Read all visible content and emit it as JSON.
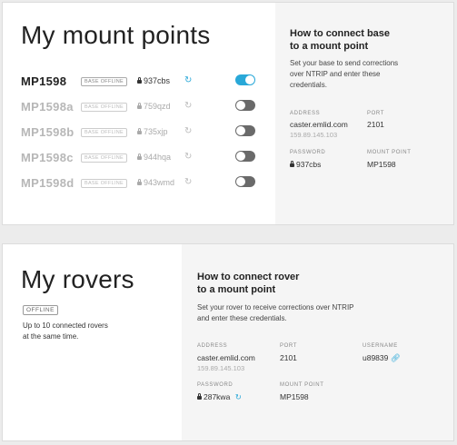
{
  "mount_card": {
    "title": "My mount points",
    "rows": [
      {
        "name": "MP1598",
        "badge": "BASE OFFLINE",
        "password": "937cbs",
        "enabled": true
      },
      {
        "name": "MP1598a",
        "badge": "BASE OFFLINE",
        "password": "759qzd",
        "enabled": false
      },
      {
        "name": "MP1598b",
        "badge": "BASE OFFLINE",
        "password": "735xjp",
        "enabled": false
      },
      {
        "name": "MP1598c",
        "badge": "BASE OFFLINE",
        "password": "944hqa",
        "enabled": false
      },
      {
        "name": "MP1598d",
        "badge": "BASE OFFLINE",
        "password": "943wmd",
        "enabled": false
      }
    ],
    "side": {
      "title_line1": "How to connect base",
      "title_line2": "to a mount point",
      "desc_line1": "Set your base to send corrections",
      "desc_line2": "over NTRIP and enter these",
      "desc_line3": "credentials.",
      "address_label": "ADDRESS",
      "address": "caster.emlid.com",
      "ip": "159.89.145.103",
      "port_label": "PORT",
      "port": "2101",
      "password_label": "PASSWORD",
      "password": "937cbs",
      "mount_label": "MOUNT POINT",
      "mount": "MP1598"
    }
  },
  "rover_card": {
    "title": "My rovers",
    "badge": "OFFLINE",
    "note_line1": "Up to 10 connected rovers",
    "note_line2": "at the same time.",
    "side": {
      "title_line1": "How to connect rover",
      "title_line2": "to a mount point",
      "desc_line1": "Set your rover to receive corrections over NTRIP",
      "desc_line2": "and enter these credentials.",
      "address_label": "ADDRESS",
      "address": "caster.emlid.com",
      "ip": "159.89.145.103",
      "port_label": "PORT",
      "port": "2101",
      "username_label": "USERNAME",
      "username": "u89839",
      "password_label": "PASSWORD",
      "password": "287kwa",
      "mount_label": "MOUNT POINT",
      "mount": "MP1598"
    }
  },
  "icons": {
    "refresh": "refresh-icon",
    "lock": "lock-icon",
    "link": "link-icon",
    "toggle": "toggle-switch"
  },
  "colors": {
    "accent": "#29a8d8",
    "toggle_off": "#6a6a6a",
    "panel": "#f5f5f5"
  }
}
